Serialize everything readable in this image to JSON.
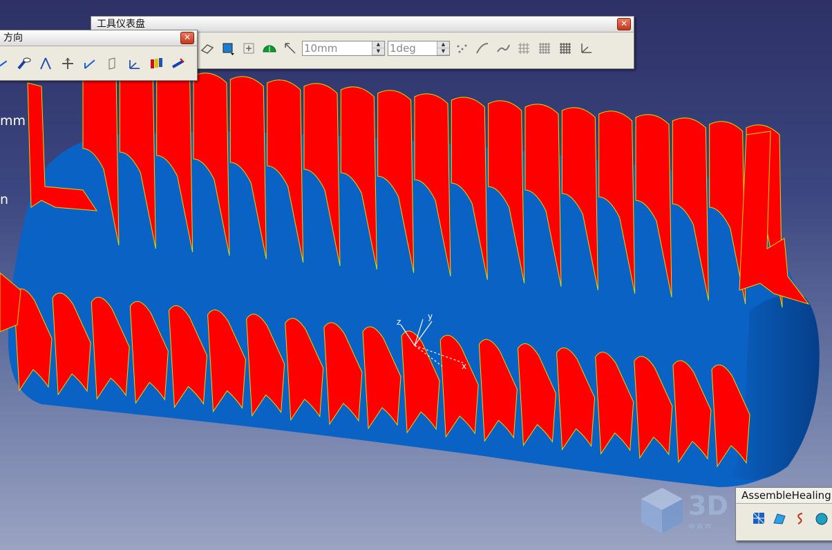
{
  "viewport": {
    "left_label_1": "mm",
    "left_label_2": "n",
    "axis_triad": {
      "x": "x",
      "y": "y",
      "z": "z"
    }
  },
  "colors": {
    "background_top": "#2d3166",
    "background_bottom": "#9aa3c2",
    "surface_blue": "#0a62c4",
    "section_red": "#ff0000",
    "edge_yellow": "#d8e000"
  },
  "toolbars": {
    "dashboard": {
      "title": "工具仪表盘",
      "length_value": "10mm",
      "angle_value": "1deg",
      "icons": [
        "sketch-plane-icon",
        "color-picker-icon",
        "plus-icon",
        "protractor-icon",
        "snap-direction-icon",
        "point-cloud-icon",
        "curve-icon",
        "spline-icon",
        "mesh-icon",
        "grid-icon",
        "grid-snap-icon",
        "axis-system-icon"
      ]
    },
    "direction": {
      "title": "方向",
      "icons": [
        "view-direction-icon",
        "eye-direction-icon",
        "compass-icon",
        "move-icon",
        "axis-arrows-icon",
        "plane-icon",
        "axis-system-icon",
        "section-planes-icon",
        "normal-direction-icon"
      ]
    },
    "assemble_healing": {
      "title": "AssembleHealing",
      "icons": [
        "healing-mesh-icon",
        "healing-surface-icon",
        "join-curve-icon",
        "healing-face-icon"
      ]
    }
  },
  "watermark": {
    "brand": "3D",
    "sub": "www"
  }
}
